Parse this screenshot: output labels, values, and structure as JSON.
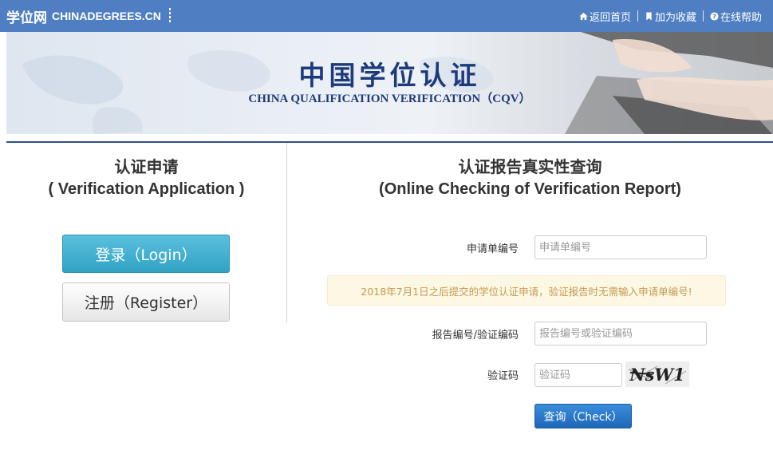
{
  "header": {
    "brand_cn": "学位网",
    "brand_en": "CHINADEGREES.CN",
    "links": [
      {
        "label": "返回首页",
        "icon": "home-icon"
      },
      {
        "label": "加为收藏",
        "icon": "bookmark-icon"
      },
      {
        "label": "在线帮助",
        "icon": "help-icon"
      }
    ]
  },
  "banner": {
    "title_cn": "中国学位认证",
    "title_en": "CHINA QUALIFICATION VERIFICATION（CQV）"
  },
  "left_panel": {
    "title_cn": "认证申请",
    "title_en": "( Verification Application )",
    "login_label": "登录（Login）",
    "register_label": "注册（Register）"
  },
  "right_panel": {
    "title_cn": "认证报告真实性查询",
    "title_en": "(Online Checking of Verification Report)",
    "app_no_label": "申请单编号",
    "app_no_placeholder": "申请单编号",
    "notice": "2018年7月1日之后提交的学位认证申请，验证报告时无需输入申请单编号!",
    "report_no_label": "报告编号/验证编码",
    "report_no_placeholder": "报告编号或验证编码",
    "captcha_label": "验证码",
    "captcha_placeholder": "验证码",
    "captcha_text": "NsW1",
    "check_label": "查询（Check）"
  },
  "colors": {
    "topbar": "#4f7fc2",
    "banner_text": "#1d3a7a",
    "login_button": "#31a2c4",
    "check_button": "#1f67b8",
    "notice_bg": "#fcf8e3",
    "notice_text": "#c39a54"
  }
}
